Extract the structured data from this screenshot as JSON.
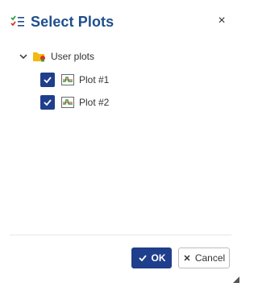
{
  "dialog": {
    "title": "Select Plots",
    "close_label": "×"
  },
  "tree": {
    "root": {
      "label": "User plots",
      "expanded": true
    },
    "items": [
      {
        "label": "Plot #1",
        "checked": true
      },
      {
        "label": "Plot #2",
        "checked": true
      }
    ]
  },
  "footer": {
    "ok_label": "OK",
    "cancel_label": "Cancel"
  },
  "colors": {
    "title": "#1f4e8c",
    "primary": "#1f3e8c",
    "folder": "#f2b90f",
    "plot_green": "#2e9e3e",
    "plot_red": "#d9352b"
  }
}
